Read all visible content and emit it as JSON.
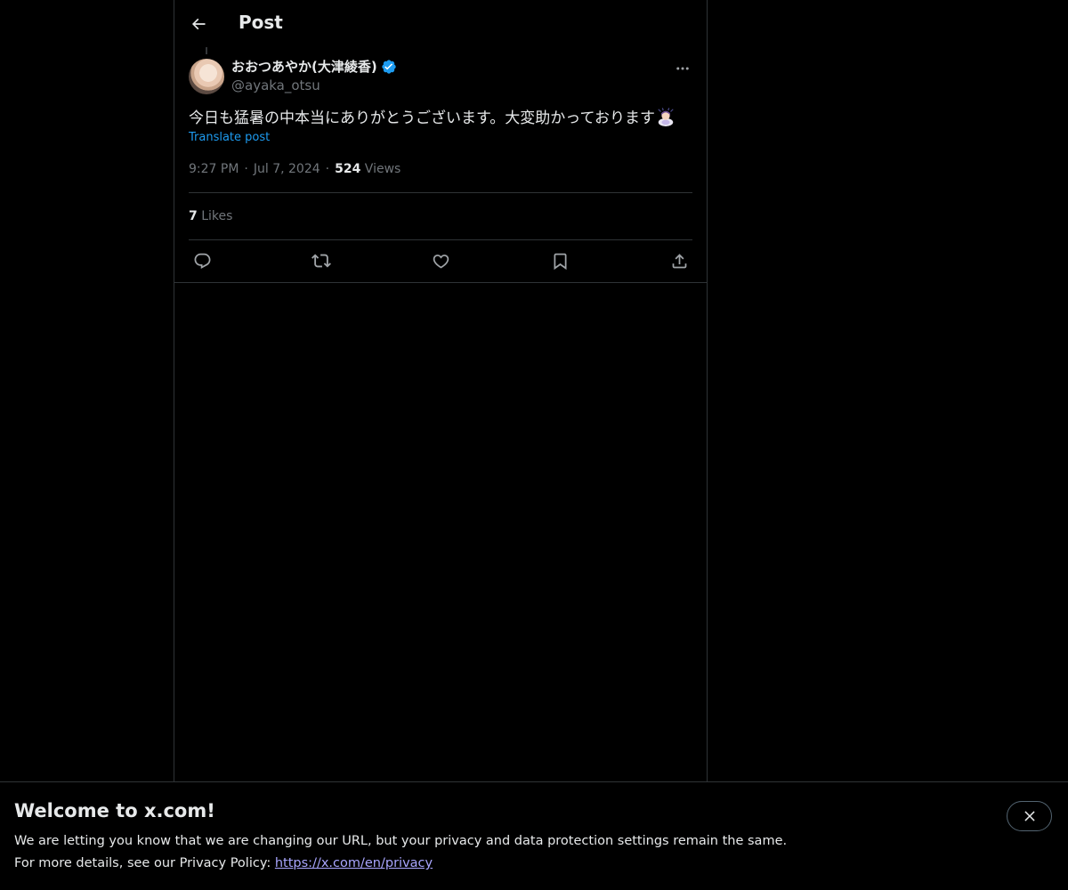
{
  "header": {
    "title": "Post",
    "back_icon": "arrow-left-icon"
  },
  "tweet": {
    "display_name": "おおつあやか(大津綾香)",
    "handle": "@ayaka_otsu",
    "verified": true,
    "text": "今日も猛暑の中本当にありがとうございます。大変助かっております",
    "emoji": "person-bowing-emoji",
    "translate_label": "Translate post",
    "time": "9:27 PM",
    "date": "Jul 7, 2024",
    "views_count": "524",
    "views_label": "Views",
    "likes_count": "7",
    "likes_label": "Likes",
    "actions": [
      "reply-icon",
      "repost-icon",
      "like-icon",
      "bookmark-icon",
      "share-icon"
    ],
    "more_icon": "more-horizontal-icon"
  },
  "banner": {
    "title": "Welcome to x.com!",
    "line1": "We are letting you know that we are changing our URL, but your privacy and data protection settings remain the same.",
    "line2_prefix": "For more details, see our Privacy Policy: ",
    "privacy_link": "https://x.com/en/privacy",
    "close_icon": "close-icon"
  },
  "colors": {
    "background": "#000000",
    "text": "#e7e9ea",
    "secondary": "#71767b",
    "accent": "#1d9bf0",
    "border": "#2f3336",
    "link": "#a9a6ff"
  }
}
